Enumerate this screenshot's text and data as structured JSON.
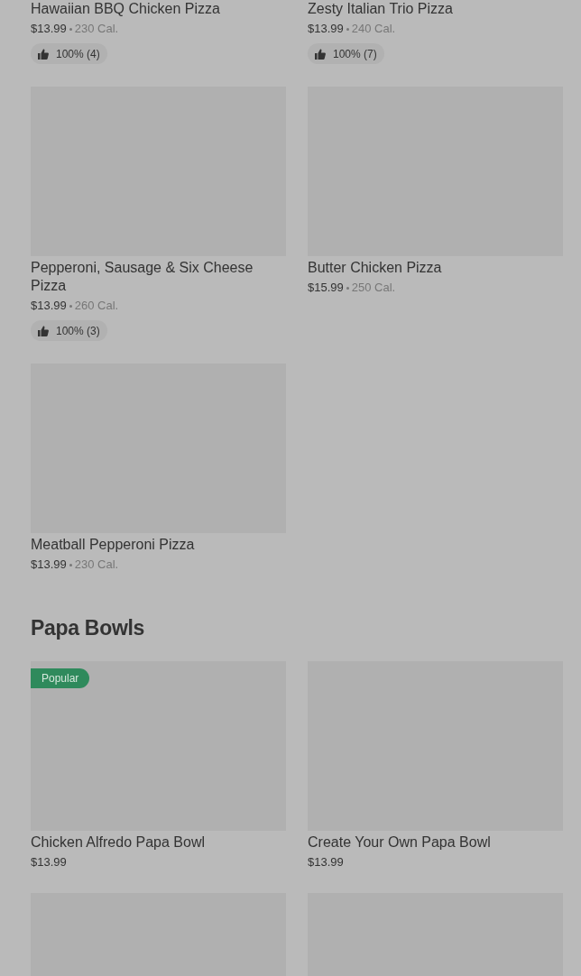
{
  "sections": [
    {
      "items": [
        {
          "picture": false,
          "name": "Hawaiian BBQ Chicken Pizza",
          "price": "$13.99",
          "calories": "230 Cal.",
          "rating": "100% (4)"
        },
        {
          "picture": false,
          "name": "Zesty Italian Trio Pizza",
          "price": "$13.99",
          "calories": "240 Cal.",
          "rating": "100% (7)"
        },
        {
          "picture": true,
          "name": "Pepperoni, Sausage & Six Cheese Pizza",
          "price": "$13.99",
          "calories": "260 Cal.",
          "rating": "100% (3)"
        },
        {
          "picture": true,
          "name": "Butter Chicken Pizza",
          "price": "$15.99",
          "calories": "250 Cal."
        },
        {
          "picture": true,
          "name": "Meatball Pepperoni Pizza",
          "price": "$13.99",
          "calories": "230 Cal."
        }
      ]
    },
    {
      "title": "Papa Bowls",
      "items": [
        {
          "picture": true,
          "badge": "Popular",
          "name": "Chicken Alfredo Papa Bowl",
          "price": "$13.99"
        },
        {
          "picture": true,
          "name": "Create Your Own Papa Bowl",
          "price": "$13.99"
        },
        {
          "picture": true
        },
        {
          "picture": true
        }
      ]
    }
  ]
}
